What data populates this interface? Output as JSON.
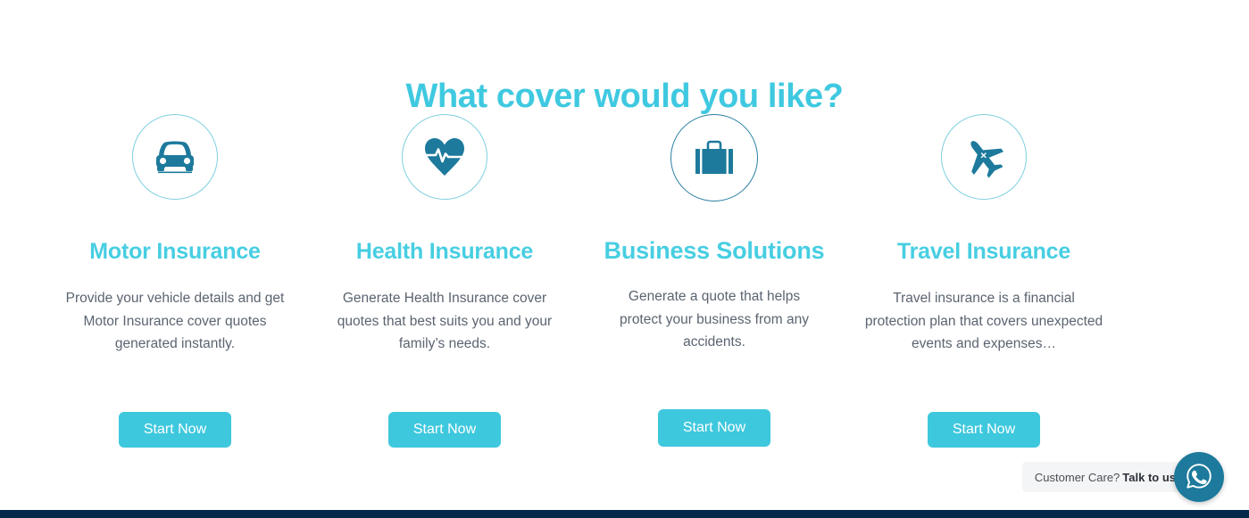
{
  "heading": "What cover would you like?",
  "colors": {
    "heading_cyan": "#3fc9e0",
    "title_cyan": "#47cee2",
    "button_cyan": "#3ec8dd",
    "icon_teal": "#1d7a9c",
    "circle_border": "#7ecfe0",
    "body_text": "#5b6470",
    "footer_navy": "#04294b"
  },
  "cards": [
    {
      "icon": "car-icon",
      "title": "Motor Insurance",
      "description": "Provide your vehicle details and get Motor Insurance cover quotes generated instantly.",
      "button_label": "Start Now"
    },
    {
      "icon": "heartbeat-icon",
      "title": "Health Insurance",
      "description": "Generate Health Insurance cover quotes that best suits you and your family’s needs.",
      "button_label": "Start Now"
    },
    {
      "icon": "briefcase-icon",
      "title": "Business Solutions",
      "description": "Generate a quote that helps protect your business from any accidents.",
      "button_label": "Start Now"
    },
    {
      "icon": "airplane-icon",
      "title": "Travel Insurance",
      "description": "Travel insurance is a financial protection plan that covers unexpected events and expenses…",
      "button_label": "Start Now"
    }
  ],
  "whatsapp_widget": {
    "prompt": "Customer Care?",
    "cta": "Talk to us",
    "icon": "whatsapp-icon"
  }
}
